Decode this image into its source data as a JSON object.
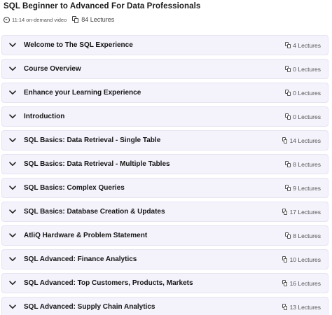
{
  "course": {
    "title": "SQL Beginner to Advanced For Data Professionals",
    "duration": "11:14 on-demand video",
    "lectures": "84 Lectures"
  },
  "sections": [
    {
      "title": "Welcome to The SQL Experience",
      "count": "4 Lectures"
    },
    {
      "title": "Course Overview",
      "count": "0 Lectures"
    },
    {
      "title": "Enhance your Learning Experience",
      "count": "0 Lectures"
    },
    {
      "title": "Introduction",
      "count": "0 Lectures"
    },
    {
      "title": "SQL Basics: Data Retrieval - Single Table",
      "count": "14 Lectures"
    },
    {
      "title": "SQL Basics: Data Retrieval - Multiple Tables",
      "count": "8 Lectures"
    },
    {
      "title": "SQL Basics: Complex Queries",
      "count": "9 Lectures"
    },
    {
      "title": "SQL Basics: Database Creation & Updates",
      "count": "17 Lectures"
    },
    {
      "title": "AtliQ Hardware & Problem Statement",
      "count": "8 Lectures"
    },
    {
      "title": "SQL Advanced: Finance Analytics",
      "count": "10 Lectures"
    },
    {
      "title": "SQL Advanced: Top Customers, Products, Markets",
      "count": "16 Lectures"
    },
    {
      "title": "SQL Advanced: Supply Chain Analytics",
      "count": "13 Lectures"
    }
  ],
  "icons": {
    "duration": "play-clock-icon",
    "lectures": "documents-icon",
    "section_toggle": "chevron-down-icon"
  },
  "colors": {
    "section_bg": "#f4f2fb",
    "section_border": "#e6e3f3"
  }
}
